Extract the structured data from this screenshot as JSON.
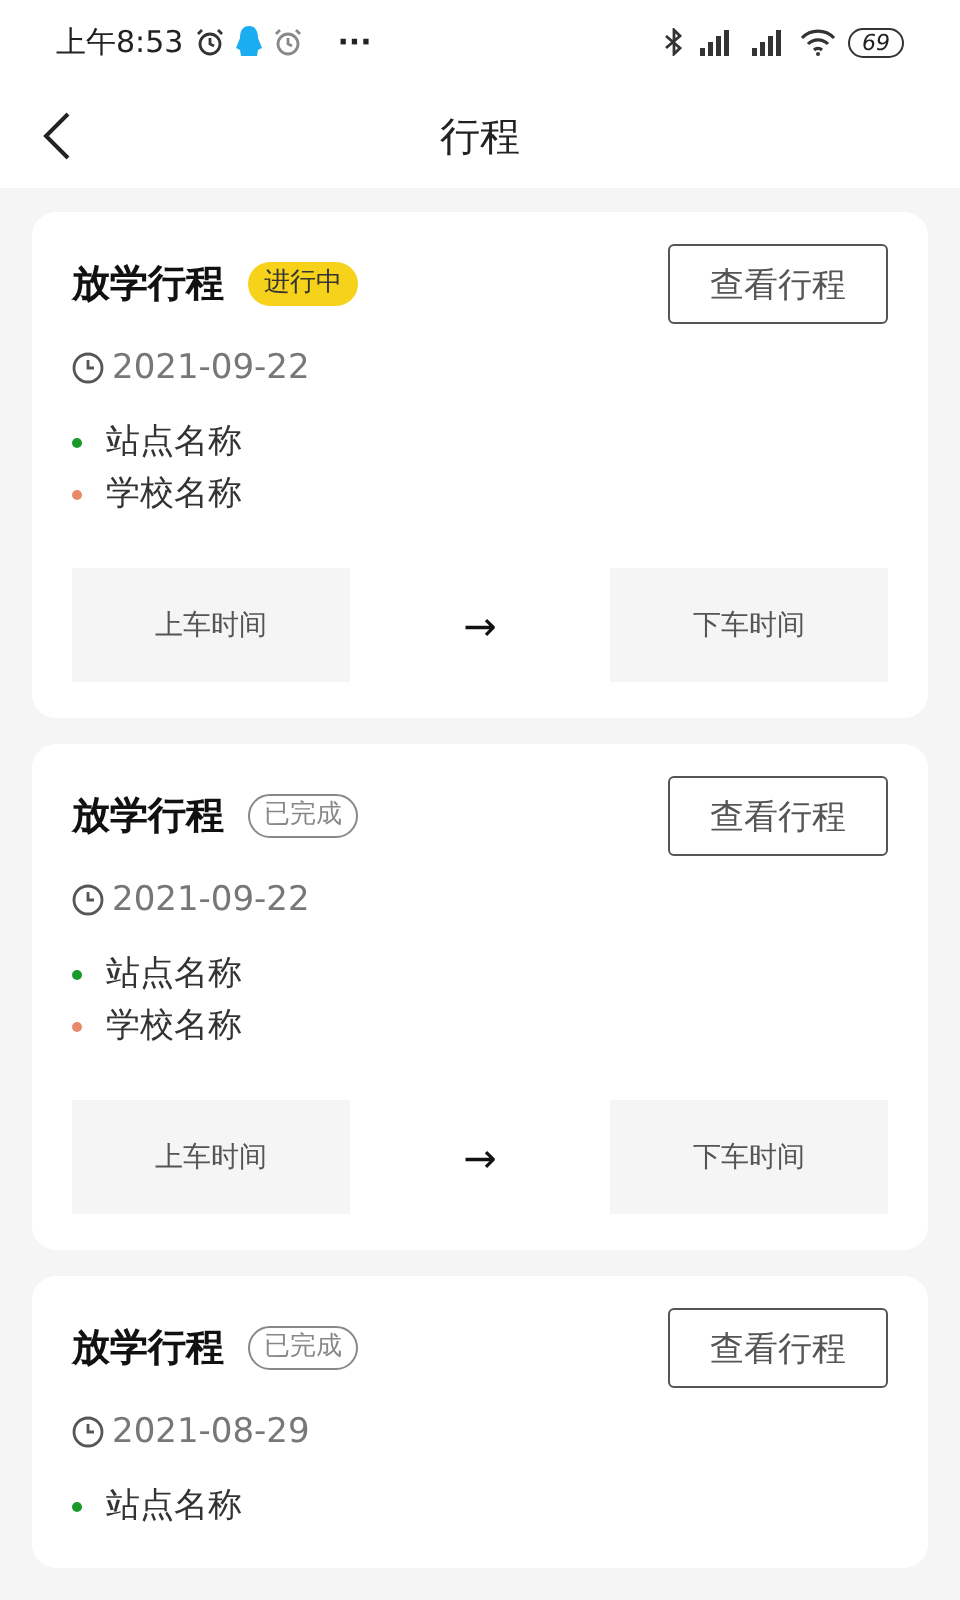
{
  "status_bar": {
    "time": "上午8:53",
    "more": "···",
    "battery": "69"
  },
  "header": {
    "title": "行程"
  },
  "trips": [
    {
      "title": "放学行程",
      "status": {
        "kind": "active",
        "label": "进行中"
      },
      "button": "查看行程",
      "date": "2021-09-22",
      "stops": [
        {
          "name": "站点名称",
          "color": "#1a9a2a"
        },
        {
          "name": "学校名称",
          "color": "#e8896a"
        }
      ],
      "board_label": "上车时间",
      "arrow": "→",
      "alight_label": "下车时间"
    },
    {
      "title": "放学行程",
      "status": {
        "kind": "done",
        "label": "已完成"
      },
      "button": "查看行程",
      "date": "2021-09-22",
      "stops": [
        {
          "name": "站点名称",
          "color": "#1a9a2a"
        },
        {
          "name": "学校名称",
          "color": "#e8896a"
        }
      ],
      "board_label": "上车时间",
      "arrow": "→",
      "alight_label": "下车时间"
    },
    {
      "title": "放学行程",
      "status": {
        "kind": "done",
        "label": "已完成"
      },
      "button": "查看行程",
      "date": "2021-08-29",
      "stops": [
        {
          "name": "站点名称",
          "color": "#1a9a2a"
        }
      ]
    }
  ]
}
